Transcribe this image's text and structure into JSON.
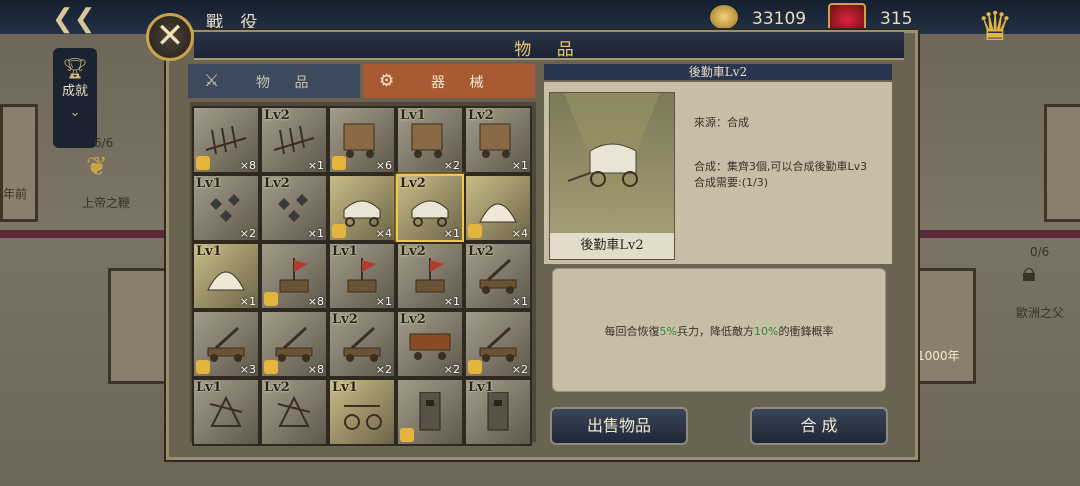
{
  "topbar": {
    "title": "戰 役",
    "gold": "33109",
    "gems": "315"
  },
  "side_left": {
    "achievements_label": "成就",
    "progress": "6/6",
    "title_label": "上帝之鞭",
    "card_label": "年前"
  },
  "side_right": {
    "progress": "0/6",
    "title_label": "歐洲之父",
    "card_label": "1000年"
  },
  "modal": {
    "title": "物 品",
    "tabs": [
      {
        "label": "物 品"
      },
      {
        "label": "器 械"
      }
    ],
    "grid": [
      {
        "lv": "",
        "count": "×8",
        "puzzle": true,
        "kind": "spikes"
      },
      {
        "lv": "Lv2",
        "count": "×1",
        "puzzle": false,
        "kind": "spikes"
      },
      {
        "lv": "",
        "count": "×6",
        "puzzle": true,
        "kind": "barrier"
      },
      {
        "lv": "Lv1",
        "count": "×2",
        "puzzle": false,
        "kind": "barrier"
      },
      {
        "lv": "Lv2",
        "count": "×1",
        "puzzle": false,
        "kind": "barrier"
      },
      {
        "lv": "Lv1",
        "count": "×2",
        "puzzle": false,
        "kind": "caltrops"
      },
      {
        "lv": "Lv2",
        "count": "×1",
        "puzzle": false,
        "kind": "caltrops"
      },
      {
        "lv": "",
        "count": "×4",
        "puzzle": true,
        "kind": "wagon",
        "gold": true
      },
      {
        "lv": "Lv2",
        "count": "×1",
        "puzzle": false,
        "kind": "wagon",
        "gold": true,
        "selected": true
      },
      {
        "lv": "",
        "count": "×4",
        "puzzle": true,
        "kind": "tent",
        "gold": true
      },
      {
        "lv": "Lv1",
        "count": "×1",
        "puzzle": false,
        "kind": "tent",
        "gold": true
      },
      {
        "lv": "",
        "count": "×8",
        "puzzle": true,
        "kind": "banner"
      },
      {
        "lv": "Lv1",
        "count": "×1",
        "puzzle": false,
        "kind": "banner"
      },
      {
        "lv": "Lv2",
        "count": "×1",
        "puzzle": false,
        "kind": "banner"
      },
      {
        "lv": "Lv2",
        "count": "×1",
        "puzzle": false,
        "kind": "catapult"
      },
      {
        "lv": "",
        "count": "×3",
        "puzzle": true,
        "kind": "catapult"
      },
      {
        "lv": "",
        "count": "×8",
        "puzzle": true,
        "kind": "catapult"
      },
      {
        "lv": "Lv2",
        "count": "×2",
        "puzzle": false,
        "kind": "catapult"
      },
      {
        "lv": "Lv2",
        "count": "×2",
        "puzzle": false,
        "kind": "ram"
      },
      {
        "lv": "",
        "count": "×2",
        "puzzle": true,
        "kind": "catapult"
      },
      {
        "lv": "Lv1",
        "count": "",
        "puzzle": false,
        "kind": "trebuchet"
      },
      {
        "lv": "Lv2",
        "count": "",
        "puzzle": false,
        "kind": "trebuchet"
      },
      {
        "lv": "Lv1",
        "count": "",
        "puzzle": false,
        "kind": "ballista",
        "gold": true
      },
      {
        "lv": "",
        "count": "",
        "puzzle": true,
        "kind": "tower"
      },
      {
        "lv": "Lv1",
        "count": "",
        "puzzle": false,
        "kind": "tower"
      }
    ],
    "detail": {
      "header": "後勤車Lv2",
      "portrait_label": "後勤車Lv2",
      "source": "來源：合成",
      "compose_line": "合成：集齊3個,可以合成後勤車Lv3",
      "compose_need": "合成需要:(1/3)",
      "desc_a": "每回合恢復",
      "desc_pct1": "5%",
      "desc_b": "兵力，降低敵方",
      "desc_pct2": "10%",
      "desc_c": "的衝鋒概率",
      "highlight_color": "#2e8a3a"
    },
    "buttons": {
      "sell": "出售物品",
      "compose": "合 成"
    }
  }
}
